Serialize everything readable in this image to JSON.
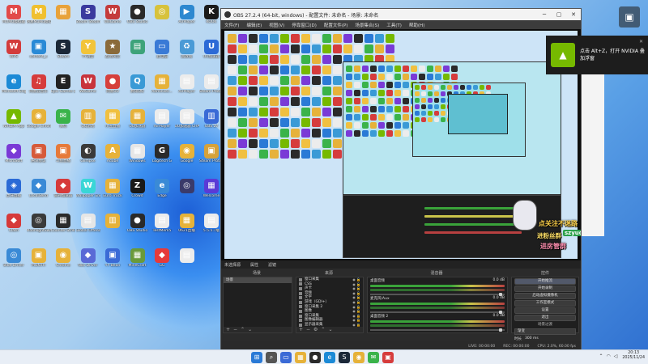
{
  "desktop": {
    "icons": [
      {
        "label": "MUMU模拟器",
        "glyph": "M",
        "color": "#e24a4a"
      },
      {
        "label": "网易MuMu模拟",
        "glyph": "M",
        "color": "#f0c030"
      },
      {
        "label": "",
        "glyph": "▦",
        "color": "#e8a23a"
      },
      {
        "label": "Steam Steam Deck",
        "glyph": "S",
        "color": "#3a3a9e"
      },
      {
        "label": "WeGame",
        "glyph": "W",
        "color": "#c43c3c"
      },
      {
        "label": "OBS Studio",
        "glyph": "●",
        "color": "#2a2a2a"
      },
      {
        "label": "",
        "glyph": "◎",
        "color": "#d7c23c"
      },
      {
        "label": "AirPlayer",
        "glyph": "▶",
        "color": "#2d88d0"
      },
      {
        "label": "KOOK",
        "glyph": "K",
        "color": "#1a1a1a"
      },
      {
        "label": "WPS",
        "glyph": "W",
        "color": "#d33c3c"
      },
      {
        "label": "content_s",
        "glyph": "▣",
        "color": "#2a8ad6"
      },
      {
        "label": "Steam",
        "glyph": "S",
        "color": "#1b2838"
      },
      {
        "label": "YY语音",
        "glyph": "Y",
        "color": "#f2c43a"
      },
      {
        "label": "战地风云",
        "glyph": "★",
        "color": "#8a6a3a"
      },
      {
        "label": "",
        "glyph": "▤",
        "color": "#3da37a"
      },
      {
        "label": "此电脑",
        "glyph": "▭",
        "color": "#3a7ad6"
      },
      {
        "label": "回收站",
        "glyph": "♻",
        "color": "#4a9ad6"
      },
      {
        "label": "UU加速器",
        "glyph": "U",
        "color": "#2d6ad6"
      },
      {
        "label": "Microsoft Edge",
        "glyph": "e",
        "color": "#1c8ad6"
      },
      {
        "label": "网易云音乐",
        "glyph": "♫",
        "color": "#d63c3c"
      },
      {
        "label": "Epic Games Launcher",
        "glyph": "E",
        "color": "#222222"
      },
      {
        "label": "WeGame",
        "glyph": "W",
        "color": "#c8343c"
      },
      {
        "label": "网易UU",
        "glyph": "●",
        "color": "#d6403c"
      },
      {
        "label": "腾讯QQ",
        "glyph": "Q",
        "color": "#3a9ad6"
      },
      {
        "label": "Administr...",
        "glyph": "▦",
        "color": "#e6b23a"
      },
      {
        "label": "AirPlayer",
        "glyph": "▤",
        "color": "#ececec"
      },
      {
        "label": "Steam Protocol",
        "glyph": "▤",
        "color": "#ececec"
      },
      {
        "label": "NVIDIA App",
        "glyph": "▲",
        "color": "#76b900"
      },
      {
        "label": "Google Chrome",
        "glyph": "◉",
        "color": "#e6b23a"
      },
      {
        "label": "微信",
        "glyph": "✉",
        "color": "#3ab34a"
      },
      {
        "label": "QQ游戏",
        "glyph": "▥",
        "color": "#e6b23a"
      },
      {
        "label": "小丑直播",
        "glyph": "▦",
        "color": "#f0c040"
      },
      {
        "label": "UU加速器",
        "glyph": "▦",
        "color": "#e6b23a"
      },
      {
        "label": "AirPlayer",
        "glyph": "▤",
        "color": "#ececec"
      },
      {
        "label": "UU加速器 CHAT",
        "glyph": "▤",
        "color": "#ececec"
      },
      {
        "label": "OBS 27",
        "glyph": "▥",
        "color": "#3a6ad6"
      },
      {
        "label": "MicroSoft",
        "glyph": "◆",
        "color": "#7a3ad6"
      },
      {
        "label": "腾讯会议",
        "glyph": "▣",
        "color": "#d65a3a"
      },
      {
        "label": "斗鱼直播",
        "glyph": "▣",
        "color": "#e67a3a"
      },
      {
        "label": "Glimpse",
        "glyph": "◐",
        "color": "#3a3a3a"
      },
      {
        "label": "Adobe",
        "glyph": "A",
        "color": "#e6b23a"
      },
      {
        "label": "Windows",
        "glyph": "▦",
        "color": "#e6e6e6"
      },
      {
        "label": "Logitech G",
        "glyph": "G",
        "color": "#2a2a2a"
      },
      {
        "label": "Google",
        "glyph": "◉",
        "color": "#e6b23a"
      },
      {
        "label": "Steam Protocol",
        "glyph": "▣",
        "color": "#d6a23a"
      },
      {
        "label": "虎牙直播",
        "glyph": "◈",
        "color": "#2a6ad6"
      },
      {
        "label": "LocalSend",
        "glyph": "◆",
        "color": "#3a8ad6"
      },
      {
        "label": "雷神加速器",
        "glyph": "◆",
        "color": "#d63a3a"
      },
      {
        "label": "Wallpaper Engine",
        "glyph": "W",
        "color": "#3ad6d6"
      },
      {
        "label": "Euro Truck",
        "glyph": "▦",
        "color": "#e6b23a"
      },
      {
        "label": "Crowd",
        "glyph": "Z",
        "color": "#1a1a1a"
      },
      {
        "label": "Edge",
        "glyph": "e",
        "color": "#3a8ad6"
      },
      {
        "label": "",
        "glyph": "◎",
        "color": "#3a3a6a"
      },
      {
        "label": "Welcome",
        "glyph": "▦",
        "color": "#5a3ad6"
      },
      {
        "label": "Clash",
        "glyph": "◆",
        "color": "#d63a3a"
      },
      {
        "label": "MoonlightSwap",
        "glyph": "◎",
        "color": "#3a3a3a"
      },
      {
        "label": "Counter-Strike",
        "glyph": "▦",
        "color": "#2a2a2a"
      },
      {
        "label": "Global Offensive",
        "glyph": "▤",
        "color": "#e6e6e6"
      },
      {
        "label": "",
        "glyph": "▥",
        "color": "#e6b23a"
      },
      {
        "label": "OBS Studio",
        "glyph": "●",
        "color": "#2a2a2a"
      },
      {
        "label": "TestMem5",
        "glyph": "▤",
        "color": "#ececec"
      },
      {
        "label": "0621直播",
        "glyph": "▦",
        "color": "#e6b23a"
      },
      {
        "label": "5.5.5.7版",
        "glyph": "▤",
        "color": "#ececec"
      },
      {
        "label": "Blue Driver",
        "glyph": "◎",
        "color": "#3a8ad6"
      },
      {
        "label": "MONTH",
        "glyph": "▣",
        "color": "#e6b23a"
      },
      {
        "label": "Chrome",
        "glyph": "◉",
        "color": "#e6b23a"
      },
      {
        "label": "Nox Driver",
        "glyph": "◆",
        "color": "#5a6ad6"
      },
      {
        "label": "YY Bean",
        "glyph": "▣",
        "color": "#3a6ad6"
      },
      {
        "label": "MineCraft",
        "glyph": "▦",
        "color": "#6a9a3a"
      },
      {
        "label": "GG",
        "glyph": "◆",
        "color": "#e63a3a"
      },
      {
        "label": "",
        "glyph": "▤",
        "color": "#ececec"
      }
    ]
  },
  "obs": {
    "title": "OBS 27.2.4 (64-bit, windows) - 配置文件: 未命名 - 场景: 未命名",
    "menu": [
      "文件(F)",
      "编辑(E)",
      "视图(V)",
      "停靠窗口(D)",
      "配置文件(P)",
      "场景集合(S)",
      "工具(T)",
      "帮助(H)"
    ],
    "scene_tabs": [
      "未选择源",
      "属性",
      "滤镜"
    ],
    "dock_titles": {
      "scenes": "场景",
      "sources": "来源",
      "mixer": "混音器",
      "controls": "控件"
    },
    "scenes": [
      "场景"
    ],
    "sources": [
      "窗口采集",
      "CSS",
      "声卡",
      "音频",
      "文字",
      "游戏（GDI+）",
      "窗口采集 2",
      "图像",
      "窗口采集",
      "图像编辑器",
      "显示器采集"
    ],
    "mixer": [
      {
        "name": "桌面音频",
        "db": "0.0 dB"
      },
      {
        "name": "麦克风/Aux",
        "db": "0.0 dB"
      },
      {
        "name": "桌面音频 2",
        "db": "0.0 dB"
      }
    ],
    "controls": [
      "开始推流",
      "开始录制",
      "启动虚拟摄像机",
      "工作室模式",
      "设置",
      "退出"
    ],
    "transitions_title": "场景过渡",
    "transition_value": "渐变",
    "duration_label": "时长",
    "duration_value": "300 ms",
    "status": [
      "LIVE: 00:00:00",
      "REC: 00:00:00",
      "CPU: 2.0%, 60.00 fps"
    ]
  },
  "overlay": {
    "line1": "点关注不迷路",
    "line2": "进粉丝群",
    "tag": "szyudiii",
    "line3": "进房管群"
  },
  "toast": {
    "logo": "▲",
    "line1": "点击 Alt+Z，打开 NVIDIA 叠",
    "line2": "加浮窗",
    "close": "✕"
  },
  "taskbar": {
    "apps": [
      {
        "glyph": "⊞",
        "color": "#2a7ad6"
      },
      {
        "glyph": "⌕",
        "color": "#555555"
      },
      {
        "glyph": "▭",
        "color": "#3a6ad6"
      },
      {
        "glyph": "▦",
        "color": "#e6b23a"
      },
      {
        "glyph": "●",
        "color": "#2a2a2a"
      },
      {
        "glyph": "e",
        "color": "#1c8ad6"
      },
      {
        "glyph": "S",
        "color": "#1b2838"
      },
      {
        "glyph": "◉",
        "color": "#e6b23a"
      },
      {
        "glyph": "✉",
        "color": "#3ab34a"
      },
      {
        "glyph": "▣",
        "color": "#d63c3c"
      }
    ],
    "time": "20:13",
    "date": "2025/11/24"
  }
}
